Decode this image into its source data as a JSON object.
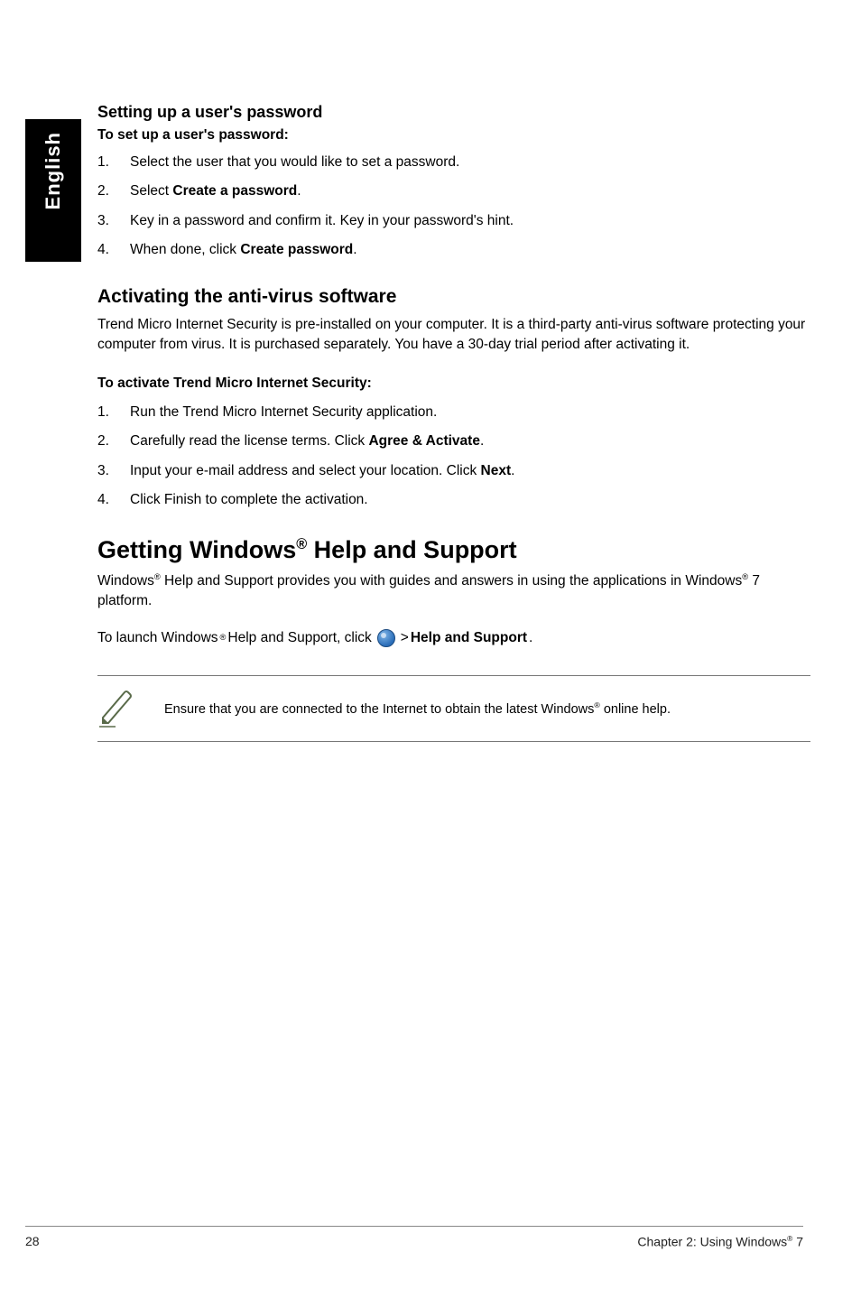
{
  "sideTab": "English",
  "section1": {
    "heading": "Setting up a user's password",
    "subhead": "To set up a user's password:",
    "steps": [
      {
        "num": "1.",
        "text_before": "Select the user that you would like to set a password."
      },
      {
        "num": "2.",
        "text_before": "Select ",
        "bold": "Create a password",
        "text_after": "."
      },
      {
        "num": "3.",
        "text_before": "Key in a password and confirm it. Key in your password's hint."
      },
      {
        "num": "4.",
        "text_before": "When done, click ",
        "bold": "Create password",
        "text_after": "."
      }
    ]
  },
  "section2": {
    "heading": "Activating the anti-virus software",
    "para": "Trend Micro Internet Security is pre-installed on your computer. It is a third-party anti-virus software protecting your computer from virus. It is purchased separately. You have a 30-day trial period after activating it.",
    "subhead": "To activate Trend Micro Internet Security:",
    "steps": [
      {
        "num": "1.",
        "text_before": "Run the Trend Micro Internet Security application."
      },
      {
        "num": "2.",
        "text_before": "Carefully read the license terms. Click ",
        "bold": "Agree & Activate",
        "text_after": "."
      },
      {
        "num": "3.",
        "text_before": "Input your e-mail address and select your location. Click ",
        "bold": "Next",
        "text_after": "."
      },
      {
        "num": "4.",
        "text_before": "Click Finish to complete the activation."
      }
    ]
  },
  "section3": {
    "heading_pre": "Getting Windows",
    "heading_sup": "®",
    "heading_post": " Help and Support",
    "para_pre": "Windows",
    "para_sup1": "®",
    "para_mid": " Help and Support provides you with guides and answers in using the applications in Windows",
    "para_sup2": "®",
    "para_post": " 7 platform.",
    "launch_pre": "To launch Windows",
    "launch_sup": "®",
    "launch_mid": " Help and Support, click ",
    "launch_gt": " > ",
    "launch_bold": "Help and Support",
    "launch_end": ".",
    "note_pre": "Ensure that you are connected to the Internet to obtain the latest Windows",
    "note_sup": "®",
    "note_post": " online help."
  },
  "footer": {
    "page": "28",
    "chapter_pre": "Chapter 2: Using Windows",
    "chapter_sup": "®",
    "chapter_post": " 7"
  }
}
